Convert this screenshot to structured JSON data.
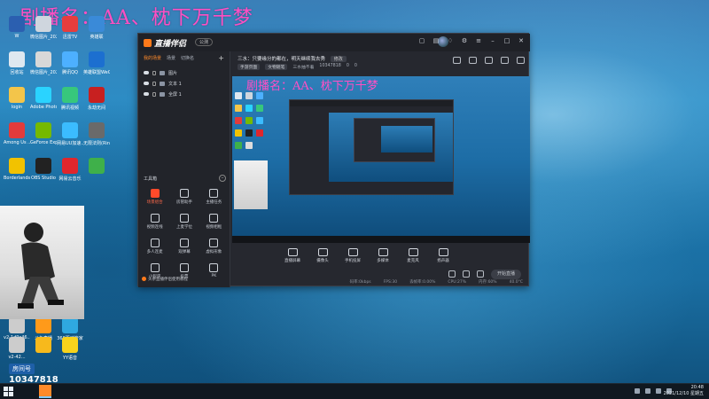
{
  "watermark": "剧播名：AA、枕下万千梦",
  "desktop": {
    "icons": [
      {
        "label": "W",
        "color": "#2b5fb0"
      },
      {
        "label": "微信图片_2021120...",
        "color": "#cfd6de"
      },
      {
        "label": "迅雷TV",
        "color": "#e63d3d"
      },
      {
        "label": "英雄联",
        "color": "#3a8ad8"
      },
      {
        "label": "回收站",
        "color": "#dfe8f0"
      },
      {
        "label": "微信图片_2021120...",
        "color": "#d8d8d8"
      },
      {
        "label": "腾讯QQ",
        "color": "#4db0ff"
      },
      {
        "label": "英雄联盟WeGame版",
        "color": "#1c6fd0"
      },
      {
        "label": "login",
        "color": "#f3c54a"
      },
      {
        "label": "Adobe Photosh...",
        "color": "#2ad3ff"
      },
      {
        "label": "腾讯视频",
        "color": "#37c77c"
      },
      {
        "label": "永劫无间",
        "color": "#c82020"
      },
      {
        "label": "Among Us ...",
        "color": "#e23b3b"
      },
      {
        "label": "GeForce Experience",
        "color": "#75b900"
      },
      {
        "label": "网易UU加速...",
        "color": "#3bbcff"
      },
      {
        "label": "无限法则(Ring of Elysium)",
        "color": "#6a6a6a"
      },
      {
        "label": "Borderlands 2",
        "color": "#f2c200"
      },
      {
        "label": "OBS Studio",
        "color": "#222222"
      },
      {
        "label": "网易云音乐",
        "color": "#e0262c"
      },
      {
        "label": "",
        "color": "#3fb04a"
      }
    ],
    "bottom_icons": [
      {
        "label": "v2-1d9c46...",
        "color": "#ccc"
      },
      {
        "label": "斗鱼直播",
        "color": "#ff9a1a"
      },
      {
        "label": "360驱动管家",
        "color": "#2fa8e0"
      },
      {
        "label": "v2-42...",
        "color": "#ccc"
      },
      {
        "label": "",
        "color": "#f7b91c"
      },
      {
        "label": "YY语音",
        "color": "#f7d31c"
      }
    ],
    "room_label": "房间号",
    "room_number": "10347818"
  },
  "app": {
    "name": "直播伴侣",
    "beta": "公测",
    "scene_tabs": [
      "我的场景",
      "场景",
      "切换名"
    ],
    "sources": [
      "图片",
      "文本 1",
      "全屏 1"
    ],
    "tools_title": "工具箱",
    "tools": [
      {
        "label": "场景组合",
        "hot": true
      },
      {
        "label": "房管助手",
        "hot": false
      },
      {
        "label": "主播任务",
        "hot": false
      },
      {
        "label": "视频连线",
        "hot": false
      },
      {
        "label": "上麦学位",
        "hot": false
      },
      {
        "label": "视频相框",
        "hot": false
      },
      {
        "label": "多人连麦",
        "hot": false
      },
      {
        "label": "观弹幕",
        "hot": false
      },
      {
        "label": "虚拟形象",
        "hot": false
      },
      {
        "label": "小程序",
        "hot": false
      },
      {
        "label": "投票",
        "hot": false
      },
      {
        "label": "PK",
        "hot": false
      }
    ],
    "tutorial": "头条直播伴侣使用教程",
    "room_title": "三水：只要缘分的都在，明天继续我去秀",
    "edit_label": "修改",
    "room_meta": [
      "手游页面",
      "文物随笔",
      "三水抽不着",
      "10347818",
      "0",
      "0"
    ],
    "bottom_tools": [
      "直播屏幕",
      "摄像头",
      "手机投屏",
      "多媒体",
      "麦克风",
      "扬声器"
    ],
    "go_live": "开始直播",
    "status": [
      "码率:0kbps",
      "FPS:30",
      "丢帧率:0.00%",
      "CPU:27%",
      "内存:60%",
      "40.0°C"
    ]
  },
  "taskbar": {
    "time": "20:48",
    "date": "2021/12/10 星期五"
  }
}
